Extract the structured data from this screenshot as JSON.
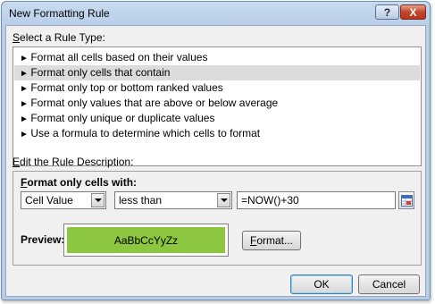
{
  "window": {
    "title": "New Formatting Rule",
    "help_label": "?",
    "close_label": "X"
  },
  "rule_type": {
    "label_accel": "S",
    "label_rest": "elect a Rule Type:",
    "arrow": "►",
    "items": [
      {
        "label": "Format all cells based on their values"
      },
      {
        "label": "Format only cells that contain"
      },
      {
        "label": "Format only top or bottom ranked values"
      },
      {
        "label": "Format only values that are above or below average"
      },
      {
        "label": "Format only unique or duplicate values"
      },
      {
        "label": "Use a formula to determine which cells to format"
      }
    ],
    "selected_index": 1
  },
  "description": {
    "label_accel": "E",
    "label_rest": "dit the Rule Description:",
    "heading_accel": "F",
    "heading_rest": "ormat only cells with:",
    "condition_type": "Cell Value",
    "operator": "less than",
    "value": "=NOW()+30",
    "preview_label": "Preview:",
    "preview_text": "AaBbCcYyZz",
    "preview_color": "#8dc63f",
    "format_accel": "F",
    "format_rest": "ormat...",
    "range_icon": "collapse-dialog-icon"
  },
  "buttons": {
    "ok": "OK",
    "cancel": "Cancel"
  }
}
